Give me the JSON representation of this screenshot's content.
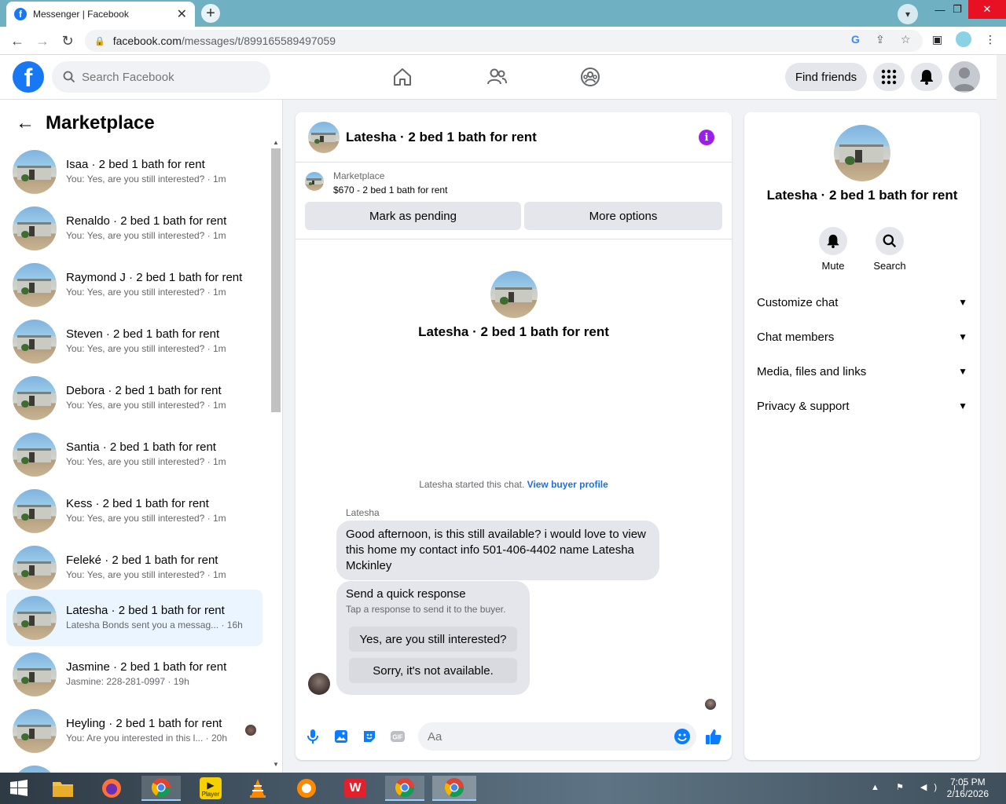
{
  "browser": {
    "tab_title": "Messenger | Facebook",
    "tab_close": "✕",
    "new_tab": "+",
    "url_host": "facebook.com",
    "url_path": "/messages/t/899165589497059"
  },
  "fbnav": {
    "logo": "f",
    "search_placeholder": "Search Facebook",
    "find_friends": "Find friends"
  },
  "sidebar": {
    "title": "Marketplace",
    "conversations": [
      {
        "name": "Isaa · 2 bed 1 bath for rent",
        "preview": "You: Yes, are you still interested? · 1m"
      },
      {
        "name": "Renaldo · 2 bed 1 bath for rent",
        "preview": "You: Yes, are you still interested? · 1m"
      },
      {
        "name": "Raymond J · 2 bed 1 bath for rent",
        "preview": "You: Yes, are you still interested? · 1m"
      },
      {
        "name": "Steven · 2 bed 1 bath for rent",
        "preview": "You: Yes, are you still interested? · 1m"
      },
      {
        "name": "Debora · 2 bed 1 bath for rent",
        "preview": "You: Yes, are you still interested? · 1m"
      },
      {
        "name": "Santia · 2 bed 1 bath for rent",
        "preview": "You: Yes, are you still interested? · 1m"
      },
      {
        "name": "Kess · 2 bed 1 bath for rent",
        "preview": "You: Yes, are you still interested? · 1m"
      },
      {
        "name": "Feleké · 2 bed 1 bath for rent",
        "preview": "You: Yes, are you still interested? · 1m"
      },
      {
        "name": "Latesha · 2 bed 1 bath for rent",
        "preview": "Latesha Bonds sent you a messag... · 16h"
      },
      {
        "name": "Jasmine · 2 bed 1 bath for rent",
        "preview": "Jasmine: 228-281-0997 · 19h"
      },
      {
        "name": "Heyling · 2 bed 1 bath for rent",
        "preview": "You: Are you interested in this l... · 20h"
      }
    ]
  },
  "chat": {
    "title": "Latesha · 2 bed 1 bath for rent",
    "listing_label": "Marketplace",
    "listing_price": "$670 - 2 bed 1 bath for rent",
    "mark_pending": "Mark as pending",
    "more_options": "More options",
    "intro_title": "Latesha · 2 bed 1 bath for rent",
    "started_text": "Latesha started this chat.",
    "view_profile": "View buyer profile",
    "sender": "Latesha",
    "message": "Good afternoon, is this still available? i would love to view this home my contact info 501-406-4402 name Latesha Mckinley",
    "quick_title": "Send a quick response",
    "quick_sub": "Tap a response to send it to the buyer.",
    "quick_yes": "Yes, are you still interested?",
    "quick_no": "Sorry, it's not available.",
    "composer_placeholder": "Aa"
  },
  "rpanel": {
    "title": "Latesha · 2 bed 1 bath for rent",
    "mute": "Mute",
    "search": "Search",
    "rows": [
      "Customize chat",
      "Chat members",
      "Media, files and links",
      "Privacy & support"
    ]
  },
  "taskbar": {
    "time": "7:05 PM",
    "date": "2/16/2026",
    "player_label": "Player"
  },
  "colors": {
    "fb_blue": "#1877f2",
    "messenger_blue": "#0a7cff",
    "info_purple": "#9b1fe8",
    "active_bg": "#ebf5ff"
  }
}
